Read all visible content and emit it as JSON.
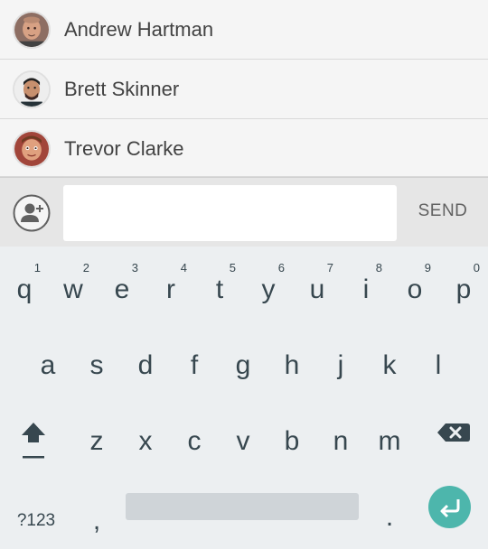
{
  "contacts": [
    {
      "name": "Andrew Hartman",
      "avatar_icon": "avatar-andrew-hartman"
    },
    {
      "name": "Brett Skinner",
      "avatar_icon": "avatar-brett-skinner"
    },
    {
      "name": "Trevor Clarke",
      "avatar_icon": "avatar-trevor-clarke"
    }
  ],
  "compose": {
    "add_contact_icon": "add-person-icon",
    "message_value": "",
    "send_label": "SEND"
  },
  "keyboard": {
    "row1": [
      {
        "key": "q",
        "hint": "1"
      },
      {
        "key": "w",
        "hint": "2"
      },
      {
        "key": "e",
        "hint": "3"
      },
      {
        "key": "r",
        "hint": "4"
      },
      {
        "key": "t",
        "hint": "5"
      },
      {
        "key": "y",
        "hint": "6"
      },
      {
        "key": "u",
        "hint": "7"
      },
      {
        "key": "i",
        "hint": "8"
      },
      {
        "key": "o",
        "hint": "9"
      },
      {
        "key": "p",
        "hint": "0"
      }
    ],
    "row2": [
      "a",
      "s",
      "d",
      "f",
      "g",
      "h",
      "j",
      "k",
      "l"
    ],
    "row3": [
      "z",
      "x",
      "c",
      "v",
      "b",
      "n",
      "m"
    ],
    "symbols_label": "?123",
    "comma": ",",
    "period": ".",
    "shift_icon": "shift-icon",
    "backspace_icon": "backspace-icon",
    "enter_icon": "enter-icon"
  },
  "colors": {
    "accent": "#4db6ac",
    "key_text": "#37474f",
    "keyboard_bg": "#eceff1"
  }
}
